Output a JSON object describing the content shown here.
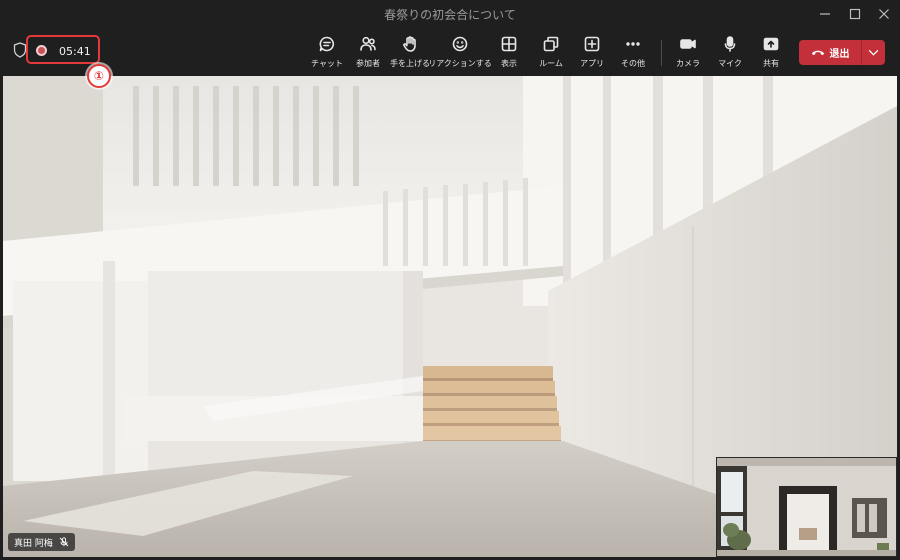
{
  "window": {
    "title": "春祭りの初会合について"
  },
  "recording": {
    "time": "05:41",
    "callout_number": "①"
  },
  "toolbar": {
    "buttons": [
      {
        "label": "チャット",
        "icon": "chat-icon"
      },
      {
        "label": "参加者",
        "icon": "people-icon"
      },
      {
        "label": "手を上げる",
        "icon": "raise-hand-icon"
      },
      {
        "label": "リアクションする",
        "icon": "reaction-icon"
      },
      {
        "label": "表示",
        "icon": "view-icon"
      },
      {
        "label": "ルーム",
        "icon": "rooms-icon"
      },
      {
        "label": "アプリ",
        "icon": "apps-icon"
      },
      {
        "label": "その他",
        "icon": "more-icon"
      },
      {
        "label": "カメラ",
        "icon": "camera-icon"
      },
      {
        "label": "マイク",
        "icon": "mic-icon"
      },
      {
        "label": "共有",
        "icon": "share-icon"
      }
    ],
    "leave_label": "退出"
  },
  "participant": {
    "name": "真田 阿梅"
  },
  "colors": {
    "background": "#1f1f1f",
    "leave_button": "#c4303a",
    "recording_highlight": "#e23a3a"
  }
}
